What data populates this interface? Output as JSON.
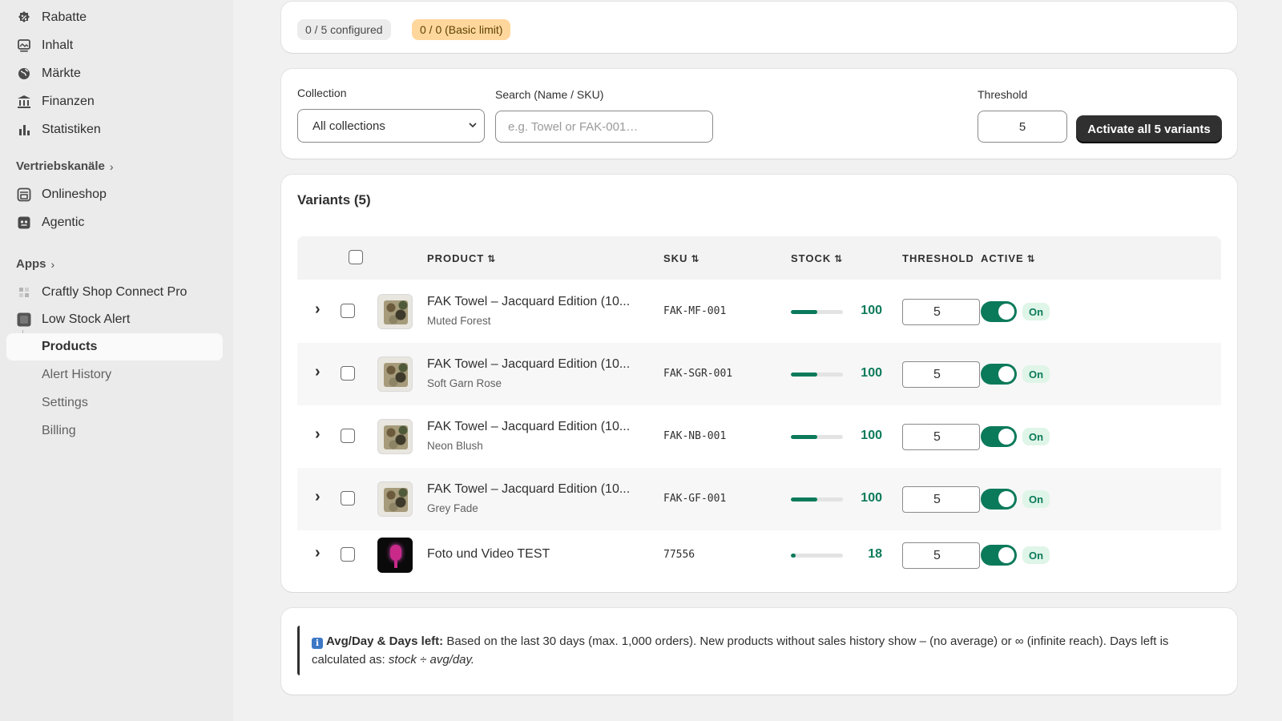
{
  "sidebar": {
    "items": [
      {
        "label": "Rabatte",
        "icon": "discount-icon"
      },
      {
        "label": "Inhalt",
        "icon": "content-icon"
      },
      {
        "label": "Märkte",
        "icon": "globe-icon"
      },
      {
        "label": "Finanzen",
        "icon": "bank-icon"
      },
      {
        "label": "Statistiken",
        "icon": "chart-icon"
      }
    ],
    "sales_channels_label": "Vertriebskanäle",
    "channels": [
      {
        "label": "Onlineshop",
        "icon": "store-icon"
      },
      {
        "label": "Agentic",
        "icon": "agentic-icon"
      }
    ],
    "apps_label": "Apps",
    "apps": [
      {
        "label": "Craftly Shop Connect Pro",
        "icon": "grid-icon"
      },
      {
        "label": "Low Stock Alert",
        "icon": "app-icon"
      }
    ],
    "subitems": [
      {
        "label": "Products",
        "active": true
      },
      {
        "label": "Alert History"
      },
      {
        "label": "Settings"
      },
      {
        "label": "Billing"
      }
    ]
  },
  "status": {
    "configured": "0 / 5 configured",
    "limit": "0 / 0 (Basic limit)"
  },
  "filters": {
    "collection_label": "Collection",
    "collection_value": "All collections",
    "search_label": "Search (Name / SKU)",
    "search_placeholder": "e.g. Towel or FAK-001…",
    "threshold_label": "Threshold",
    "threshold_value": "5",
    "activate_button": "Activate all 5 variants"
  },
  "variants": {
    "title": "Variants (5)",
    "columns": {
      "product": "PRODUCT",
      "sku": "SKU",
      "stock": "STOCK",
      "threshold": "THRESHOLD",
      "active": "ACTIVE"
    },
    "sort_glyph": "⇅",
    "rows": [
      {
        "name": "FAK Towel – Jacquard Edition (10...",
        "variant": "Muted Forest",
        "sku": "FAK-MF-001",
        "stock": "100",
        "stock_fraction": 0.5,
        "threshold": "5",
        "active": "On",
        "thumb": "camo"
      },
      {
        "name": "FAK Towel – Jacquard Edition (10...",
        "variant": "Soft Garn Rose",
        "sku": "FAK-SGR-001",
        "stock": "100",
        "stock_fraction": 0.5,
        "threshold": "5",
        "active": "On",
        "thumb": "camo"
      },
      {
        "name": "FAK Towel – Jacquard Edition (10...",
        "variant": "Neon Blush",
        "sku": "FAK-NB-001",
        "stock": "100",
        "stock_fraction": 0.5,
        "threshold": "5",
        "active": "On",
        "thumb": "camo"
      },
      {
        "name": "FAK Towel – Jacquard Edition (10...",
        "variant": "Grey Fade",
        "sku": "FAK-GF-001",
        "stock": "100",
        "stock_fraction": 0.5,
        "threshold": "5",
        "active": "On",
        "thumb": "camo"
      },
      {
        "name": "Foto und Video TEST",
        "variant": "",
        "sku": "77556",
        "stock": "18",
        "stock_fraction": 0.09,
        "threshold": "5",
        "active": "On",
        "thumb": "dark"
      }
    ]
  },
  "note": {
    "icon": "ℹ",
    "heading": "Avg/Day & Days left:",
    "text": "Based on the last 30 days (max. 1,000 orders). New products without sales history show – (no average) or ∞ (infinite reach). Days left is calculated as:",
    "formula": "stock ÷ avg/day."
  },
  "colors": {
    "accent": "#0b7a5a",
    "warning_badge": "#ffd79d",
    "button_dark": "#303030"
  }
}
